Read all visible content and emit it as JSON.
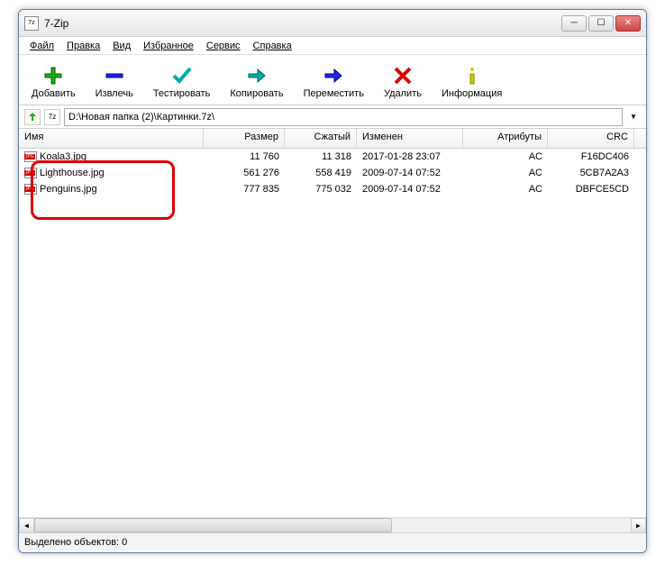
{
  "window": {
    "title": "7-Zip",
    "icon_text": "7z"
  },
  "menu": {
    "file": "Файл",
    "edit": "Правка",
    "view": "Вид",
    "favorites": "Избранное",
    "tools": "Сервис",
    "help": "Справка"
  },
  "toolbar": {
    "add": "Добавить",
    "extract": "Извлечь",
    "test": "Тестировать",
    "copy": "Копировать",
    "move": "Переместить",
    "delete": "Удалить",
    "info": "Информация"
  },
  "path": {
    "value": "D:\\Новая папка (2)\\Картинки.7z\\"
  },
  "columns": {
    "name": "Имя",
    "size": "Размер",
    "packed": "Сжатый",
    "modified": "Изменен",
    "attributes": "Атрибуты",
    "crc": "CRC"
  },
  "files": [
    {
      "name": "Koala3.jpg",
      "size": "11 760",
      "packed": "11 318",
      "modified": "2017-01-28 23:07",
      "attr": "AC",
      "crc": "F16DC406"
    },
    {
      "name": "Lighthouse.jpg",
      "size": "561 276",
      "packed": "558 419",
      "modified": "2009-07-14 07:52",
      "attr": "AC",
      "crc": "5CB7A2A3"
    },
    {
      "name": "Penguins.jpg",
      "size": "777 835",
      "packed": "775 032",
      "modified": "2009-07-14 07:52",
      "attr": "AC",
      "crc": "DBFCE5CD"
    }
  ],
  "status": {
    "text": "Выделено объектов: 0"
  }
}
